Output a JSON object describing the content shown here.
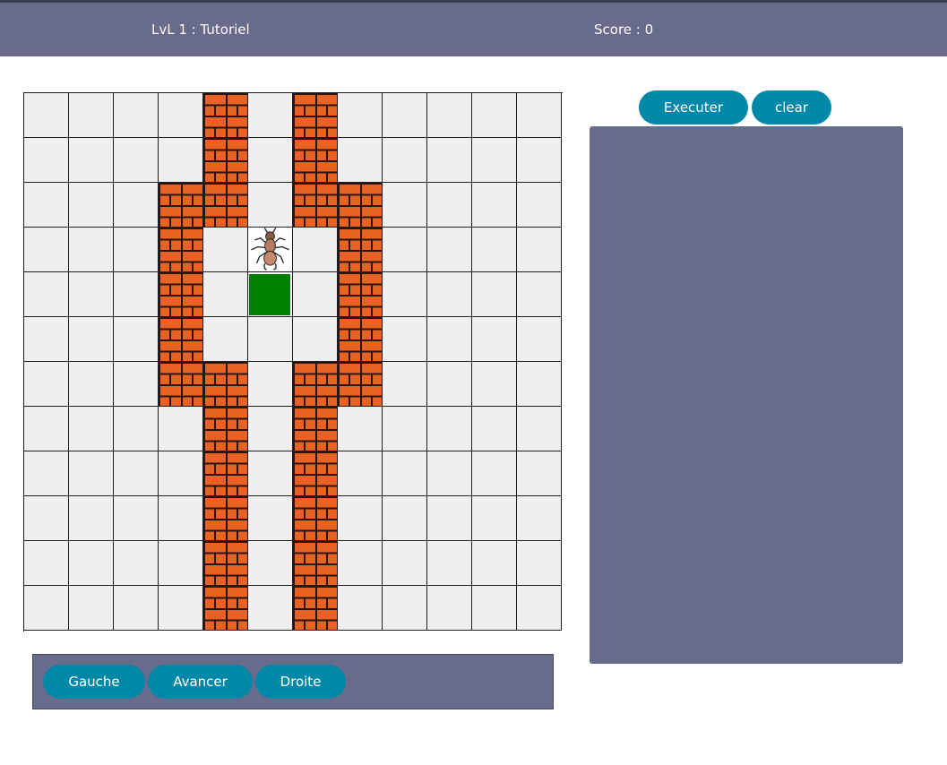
{
  "header": {
    "level_title": "LvL 1 : Tutoriel",
    "score": "Score : 0"
  },
  "board": {
    "rows": 12,
    "cols": 12,
    "wall_cells": [
      [
        0,
        4
      ],
      [
        0,
        6
      ],
      [
        1,
        4
      ],
      [
        1,
        6
      ],
      [
        2,
        3
      ],
      [
        2,
        4
      ],
      [
        2,
        6
      ],
      [
        2,
        7
      ],
      [
        3,
        3
      ],
      [
        3,
        7
      ],
      [
        4,
        3
      ],
      [
        4,
        7
      ],
      [
        5,
        3
      ],
      [
        5,
        7
      ],
      [
        6,
        3
      ],
      [
        6,
        4
      ],
      [
        6,
        6
      ],
      [
        6,
        7
      ],
      [
        7,
        4
      ],
      [
        7,
        6
      ],
      [
        8,
        4
      ],
      [
        8,
        6
      ],
      [
        9,
        4
      ],
      [
        9,
        6
      ],
      [
        10,
        4
      ],
      [
        10,
        6
      ],
      [
        11,
        4
      ],
      [
        11,
        6
      ]
    ],
    "player": {
      "row": 3,
      "col": 5,
      "icon": "ant-icon",
      "facing": "down"
    },
    "goal": {
      "row": 4,
      "col": 5
    },
    "colors": {
      "cell": "#efefef",
      "goal": "#008000",
      "wall": "#e86224"
    }
  },
  "controls": {
    "left": "Gauche",
    "forward": "Avancer",
    "right": "Droite"
  },
  "actions": {
    "execute": "Executer",
    "clear": "clear"
  },
  "program_panel": {
    "commands": []
  },
  "colors": {
    "header_bg": "#686b8c",
    "button_bg": "#0088a8",
    "panel_bg": "#686b8c"
  }
}
